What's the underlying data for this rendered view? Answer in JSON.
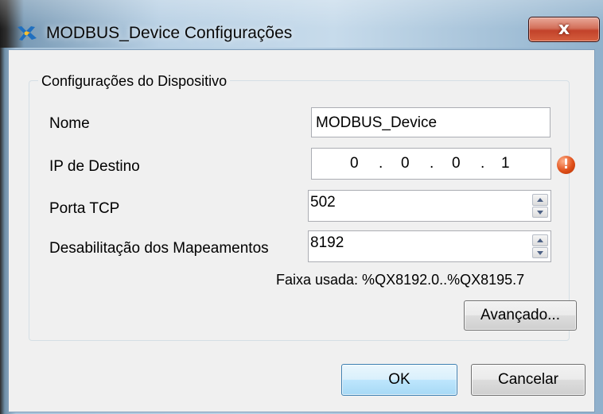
{
  "window": {
    "title": "MODBUS_Device Configurações",
    "close_glyph": "x"
  },
  "group": {
    "title": "Configurações do Dispositivo"
  },
  "fields": {
    "nome": {
      "label": "Nome",
      "value": "MODBUS_Device"
    },
    "ip": {
      "label": "IP de Destino",
      "octets": [
        "0",
        "0",
        "0",
        "1"
      ],
      "separator": ".",
      "error_glyph": "!"
    },
    "porta": {
      "label": "Porta TCP",
      "value": "502"
    },
    "desab": {
      "label": "Desabilitação dos Mapeamentos",
      "value": "8192"
    }
  },
  "range_text": "Faixa usada: %QX8192.0..%QX8195.7",
  "buttons": {
    "advanced": "Avançado...",
    "ok": "OK",
    "cancel": "Cancelar"
  },
  "icons": {
    "app": "plc-app-icon",
    "close": "close-icon",
    "error": "error-icon",
    "spin_up": "spin-up-arrow-icon",
    "spin_down": "spin-down-arrow-icon"
  },
  "colors": {
    "error": "#e0501a",
    "close_button": "#c2422a",
    "default_button_border": "#3c7fb1"
  }
}
